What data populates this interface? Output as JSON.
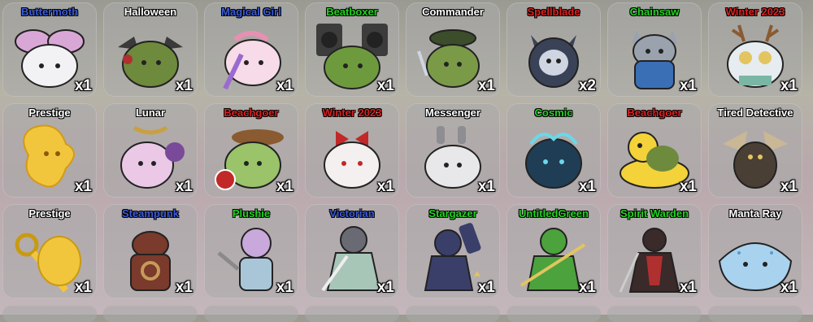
{
  "cards": [
    {
      "name": "Buttermoth",
      "count": "x1",
      "title_color": "#3b5bd9",
      "body": "#f2f2f5",
      "accent": "#d9a7d6",
      "icon": "moth-icon"
    },
    {
      "name": "Halloween",
      "count": "x1",
      "title_color": "#ffffff",
      "body": "#6e8a3c",
      "accent": "#b0302f",
      "icon": "bat-icon"
    },
    {
      "name": "Magical Girl",
      "count": "x1",
      "title_color": "#3b5bd9",
      "body": "#f7dbe8",
      "accent": "#9b6ad0",
      "icon": "wand-icon"
    },
    {
      "name": "Beatboxer",
      "count": "x1",
      "title_color": "#22d422",
      "body": "#6e9a3e",
      "accent": "#3c3c3c",
      "icon": "speaker-icon"
    },
    {
      "name": "Commander",
      "count": "x1",
      "title_color": "#ffffff",
      "body": "#7a9a48",
      "accent": "#3b4d2a",
      "icon": "cap-icon"
    },
    {
      "name": "Spellblade",
      "count": "x2",
      "title_color": "#e02020",
      "body": "#3a4257",
      "accent": "#cfd6e2",
      "icon": "sword-icon"
    },
    {
      "name": "Chainsaw",
      "count": "x1",
      "title_color": "#22d422",
      "body": "#9aa3ad",
      "accent": "#3a6fb6",
      "icon": "cat-icon"
    },
    {
      "name": "Winter 2023",
      "count": "x1",
      "title_color": "#e02020",
      "body": "#e6ecef",
      "accent": "#7ab6a4",
      "icon": "antler-icon"
    },
    {
      "name": "Prestige",
      "count": "x1",
      "title_color": "#ffffff",
      "body": "#f2c63c",
      "accent": "#d39a18",
      "icon": "star-icon"
    },
    {
      "name": "Lunar",
      "count": "x1",
      "title_color": "#ffffff",
      "body": "#eac8e6",
      "accent": "#7a4a9a",
      "icon": "moon-icon"
    },
    {
      "name": "Beachgoer",
      "count": "x1",
      "title_color": "#e02020",
      "body": "#9ac36a",
      "accent": "#8a5a30",
      "icon": "hat-icon"
    },
    {
      "name": "Winter 2023",
      "count": "x1",
      "title_color": "#e02020",
      "body": "#f4f0f0",
      "accent": "#c22828",
      "icon": "bow-icon"
    },
    {
      "name": "Messenger",
      "count": "x1",
      "title_color": "#ffffff",
      "body": "#e8e8ea",
      "accent": "#8d8d92",
      "icon": "envelope-icon"
    },
    {
      "name": "Cosmic",
      "count": "x1",
      "title_color": "#22d422",
      "body": "#1f3e55",
      "accent": "#6ad8e8",
      "icon": "galaxy-icon"
    },
    {
      "name": "Beachgoer",
      "count": "x1",
      "title_color": "#e02020",
      "body": "#f3d23a",
      "accent": "#6e8a3c",
      "icon": "duck-icon"
    },
    {
      "name": "Tired Detective",
      "count": "x1",
      "title_color": "#ffffff",
      "body": "#4a3f35",
      "accent": "#c9b796",
      "icon": "dragon-icon"
    },
    {
      "name": "Prestige",
      "count": "x1",
      "title_color": "#ffffff",
      "body": "#f2c63c",
      "accent": "#c99a10",
      "icon": "scissors-icon"
    },
    {
      "name": "Steampunk",
      "count": "x1",
      "title_color": "#3b5bd9",
      "body": "#7a3a2c",
      "accent": "#c79a5a",
      "icon": "gear-icon"
    },
    {
      "name": "Plushie",
      "count": "x1",
      "title_color": "#22d422",
      "body": "#c9a8dc",
      "accent": "#8a8a8a",
      "icon": "needle-icon"
    },
    {
      "name": "Victorian",
      "count": "x1",
      "title_color": "#3b5bd9",
      "body": "#6a6a74",
      "accent": "#a8c6b8",
      "icon": "blade-icon"
    },
    {
      "name": "Stargazer",
      "count": "x1",
      "title_color": "#22d422",
      "body": "#3a3f6a",
      "accent": "#e2c560",
      "icon": "telescope-icon"
    },
    {
      "name": "UntitledGreen",
      "count": "x1",
      "title_color": "#22d422",
      "body": "#4ca23c",
      "accent": "#e2c560",
      "icon": "leaf-icon"
    },
    {
      "name": "Spirit Warden",
      "count": "x1",
      "title_color": "#22d422",
      "body": "#3a2a2a",
      "accent": "#b0302f",
      "icon": "lantern-icon"
    },
    {
      "name": "Manta Ray",
      "count": "x1",
      "title_color": "#ffffff",
      "body": "#a9d2ee",
      "accent": "#5f9bc8",
      "icon": "manta-icon"
    }
  ]
}
